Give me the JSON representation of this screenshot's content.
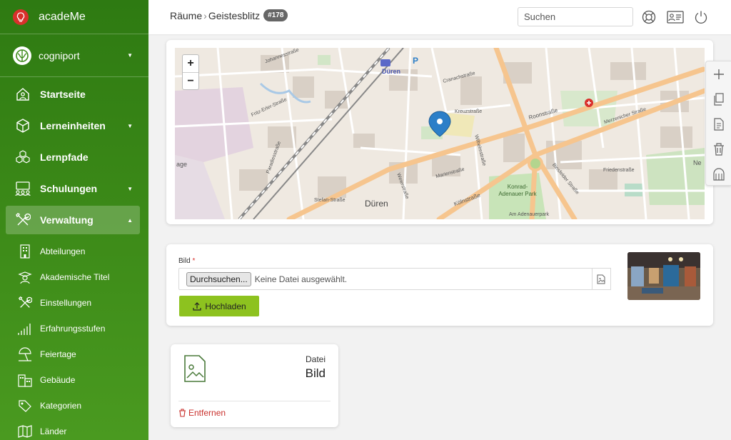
{
  "app": {
    "name": "acadeMe"
  },
  "org": {
    "name": "cogniport"
  },
  "nav": {
    "items": [
      {
        "label": "Startseite"
      },
      {
        "label": "Lerneinheiten"
      },
      {
        "label": "Lernpfade"
      },
      {
        "label": "Schulungen"
      },
      {
        "label": "Verwaltung"
      }
    ],
    "sub_items": [
      {
        "label": "Abteilungen"
      },
      {
        "label": "Akademische Titel"
      },
      {
        "label": "Einstellungen"
      },
      {
        "label": "Erfahrungsstufen"
      },
      {
        "label": "Feiertage"
      },
      {
        "label": "Gebäude"
      },
      {
        "label": "Kategorien"
      },
      {
        "label": "Länder"
      }
    ]
  },
  "header": {
    "breadcrumb_parent": "Räume",
    "breadcrumb_current": "Geistesblitz",
    "id_badge": "#178",
    "search_placeholder": "Suchen"
  },
  "map": {
    "zoom_in": "+",
    "zoom_out": "−",
    "labels": [
      "Düren",
      "Düren",
      "Kölnstraße",
      "Konrad-Adenauer Park",
      "Kreuzstraße",
      "Roonstraße",
      "Merzenicher Straße",
      "Friedenstraße",
      "Wilhelmstraße",
      "Marienstraße",
      "Fritz-Erler-Straße",
      "Am Adenauerpark",
      "Binsfelder Straße",
      "Paradiesstraße",
      "Weierstraße",
      "Cranachstraße",
      "Johannesstraße",
      "Stefan-Straße",
      "P",
      "age",
      "Ne"
    ]
  },
  "upload": {
    "label": "Bild",
    "required_mark": "*",
    "browse_label": "Durchsuchen...",
    "status": "Keine Datei ausgewählt.",
    "upload_label": "Hochladen"
  },
  "file_card": {
    "kind": "Datei",
    "name": "Bild",
    "remove_label": "Entfernen"
  },
  "colors": {
    "sidebar_green": "#3c8a18",
    "accent": "#8dc21f",
    "danger": "#c9302c"
  }
}
